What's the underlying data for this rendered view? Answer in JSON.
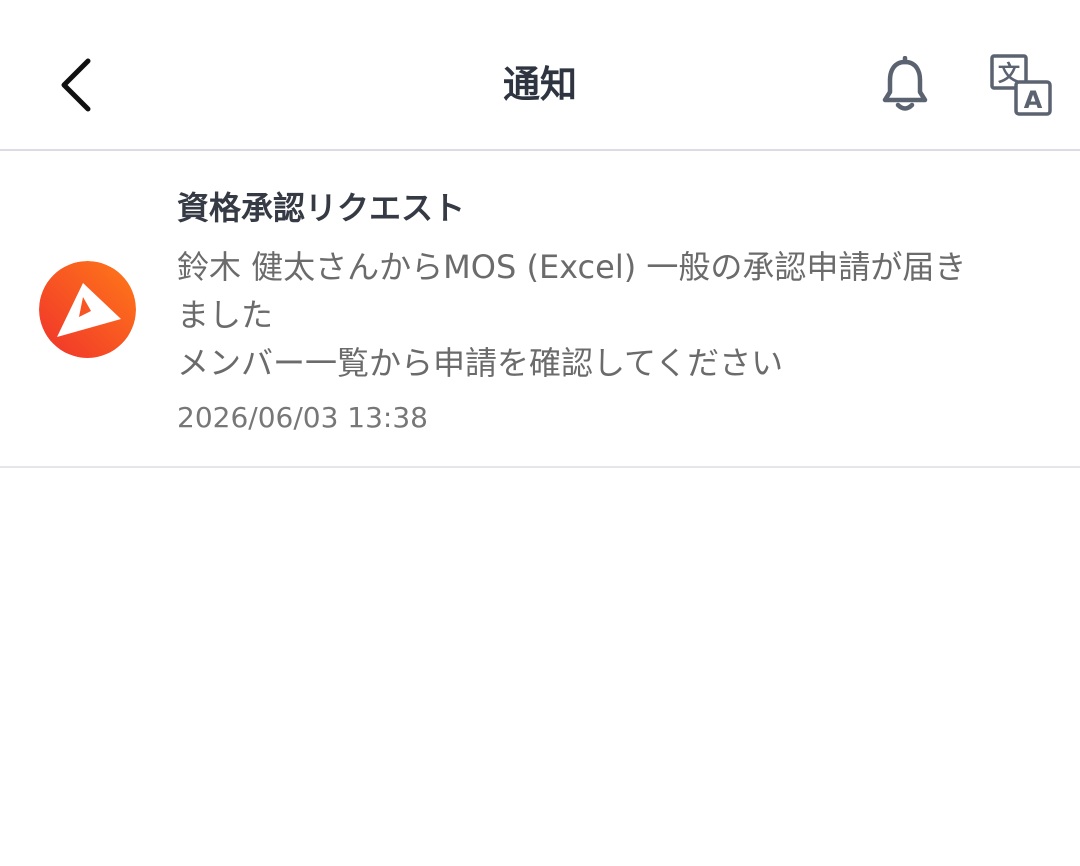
{
  "header": {
    "title": "通知",
    "back_icon": "chevron-left-icon",
    "bell_icon": "bell-icon",
    "translate_icon": "translate-icon",
    "translate_glyph_source": "文",
    "translate_glyph_target": "A"
  },
  "notifications": [
    {
      "title": "資格承認リクエスト",
      "body_lines": [
        "鈴木 健太さんからMOS (Excel) 一般の承認申請が届き",
        "ました",
        "メンバー一覧から申請を確認してください"
      ],
      "timestamp": "2026/06/03 13:38",
      "avatar_icon": "app-logo-icon"
    }
  ],
  "colors": {
    "title_text": "#2f3540",
    "body_text": "#6b6b6b",
    "icon_gray": "#5b6270",
    "divider": "#dcdce2",
    "logo_gradient_start": "#ff7a18",
    "logo_gradient_end": "#f0322c"
  }
}
